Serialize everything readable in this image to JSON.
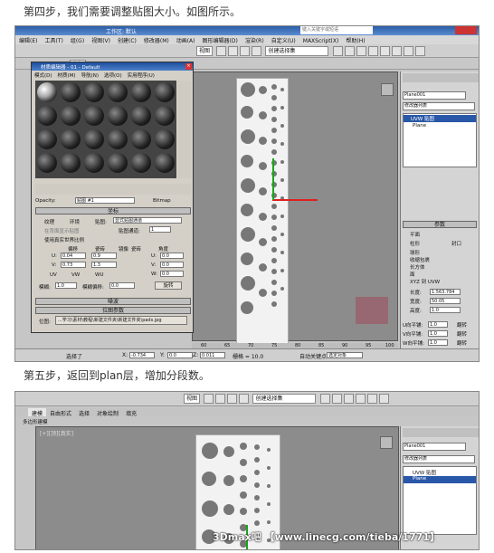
{
  "step4_text": "第四步，我们需要调整贴图大小。如图所示。",
  "step5_text": "第五步，返回到plan层，增加分段数。",
  "shot1": {
    "menus": [
      "编辑(E)",
      "工具(T)",
      "组(G)",
      "视图(V)",
      "创建(C)",
      "修改器(M)",
      "动画(A)",
      "图形编辑器(D)",
      "渲染(R)",
      "自定义(U)",
      "MAXScript(X)",
      "帮助(H)"
    ],
    "search_placeholder": "键入关键字或短语",
    "workspace_label": "工作区: 默认",
    "toolbar_select": "全部",
    "view_select": "视图",
    "named_set": "创建选择集",
    "material_editor": {
      "title": "材质编辑器 - 01 - Default",
      "menus": [
        "模式(D)",
        "材质(M)",
        "导航(N)",
        "选项(O)",
        "实用程序(U)"
      ],
      "map_name": "贴图 #1",
      "map_type": "Bitmap",
      "opacity_label": "Opacity:",
      "coords_header": "坐标",
      "texture_label": "纹理",
      "env_label": "环境",
      "mapping_label": "贴图:",
      "mapping_value": "显式贴图通道",
      "show_on_back": "在背面显示贴图",
      "channel_label": "贴图通道:",
      "channel_value": "1",
      "real_world": "使用真实世界比例",
      "offset_label": "偏移",
      "tiling_label": "瓷砖",
      "mirror_label": "镜像",
      "tile_label": "瓷砖",
      "angle_label": "角度",
      "u_label": "U:",
      "v_label": "V:",
      "w_label": "W:",
      "u_offset": "0.04",
      "v_offset": "0.73",
      "u_tiling": "0.9",
      "v_tiling": "1.3",
      "u_angle": "0.0",
      "v_angle": "0.0",
      "w_angle": "0.0",
      "uv_label": "UV",
      "vw_label": "VW",
      "wu_label": "WU",
      "blur_label": "模糊:",
      "blur_value": "1.0",
      "blur_offset_label": "模糊偏移:",
      "blur_offset_value": "0.0",
      "rotate_button": "旋转",
      "noise_header": "噪波",
      "bitmap_params_header": "位图参数",
      "bitmap_label": "位图:",
      "bitmap_path": "...学习\\素材\\教程\\新建文件夹\\新建文件夹\\pads.jpg"
    },
    "command_panel": {
      "object_name": "Plane001",
      "modifier_list": "修改器列表",
      "stack_item": "UVW 贴图",
      "stack_base": "Plane",
      "params_header": "参数",
      "mapping_options": [
        "平面",
        "柱形",
        "球形",
        "收缩包裹",
        "长方体",
        "面",
        "XYZ 到 UVW"
      ],
      "cap_label": "封口",
      "length_label": "长度:",
      "length_value": "1.563.784",
      "width_label": "宽度:",
      "width_value": "50.05",
      "height_label": "高度:",
      "height_value": "1.0",
      "u_tile_label": "U向平铺:",
      "u_tile_value": "1.0",
      "v_tile_label": "V向平铺:",
      "v_tile_value": "1.0",
      "w_tile_label": "W向平铺:",
      "w_tile_value": "1.0",
      "flip_label": "翻转",
      "real_world_label": "真实世界贴图大小"
    },
    "status": {
      "selected": "选择了",
      "x_label": "X:",
      "x_value": "-0.734",
      "y_label": "Y:",
      "y_value": "0.0",
      "z_label": "Z:",
      "z_value": "0.011",
      "grid_label": "栅格 = 10.0",
      "autokey": "自动关键点",
      "filter": "选定对象"
    },
    "timeline_ticks": [
      "60",
      "65",
      "70",
      "75",
      "80",
      "85",
      "90",
      "95",
      "100"
    ]
  },
  "shot2": {
    "tabs": [
      "建模",
      "自由形式",
      "选择",
      "对象绘制",
      "填充"
    ],
    "ribbon_label": "多边形建模",
    "viewport_label": "[+][顶][真实]",
    "view_select": "视图",
    "named_set": "创建选择集",
    "command_panel": {
      "object_name": "Plane001",
      "modifier_list": "修改器列表",
      "stack_item": "UVW 贴图",
      "stack_base": "Plane"
    }
  },
  "watermark": "3Dmax吧 【www.linecg.com/tieba/1771】",
  "colors": {
    "viewport_bg": "#8c8c8c",
    "panel_bg": "#d4d4d4",
    "title_blue": "#2b5ea8",
    "axis_red": "#e0201f",
    "axis_green": "#1aa51a"
  }
}
